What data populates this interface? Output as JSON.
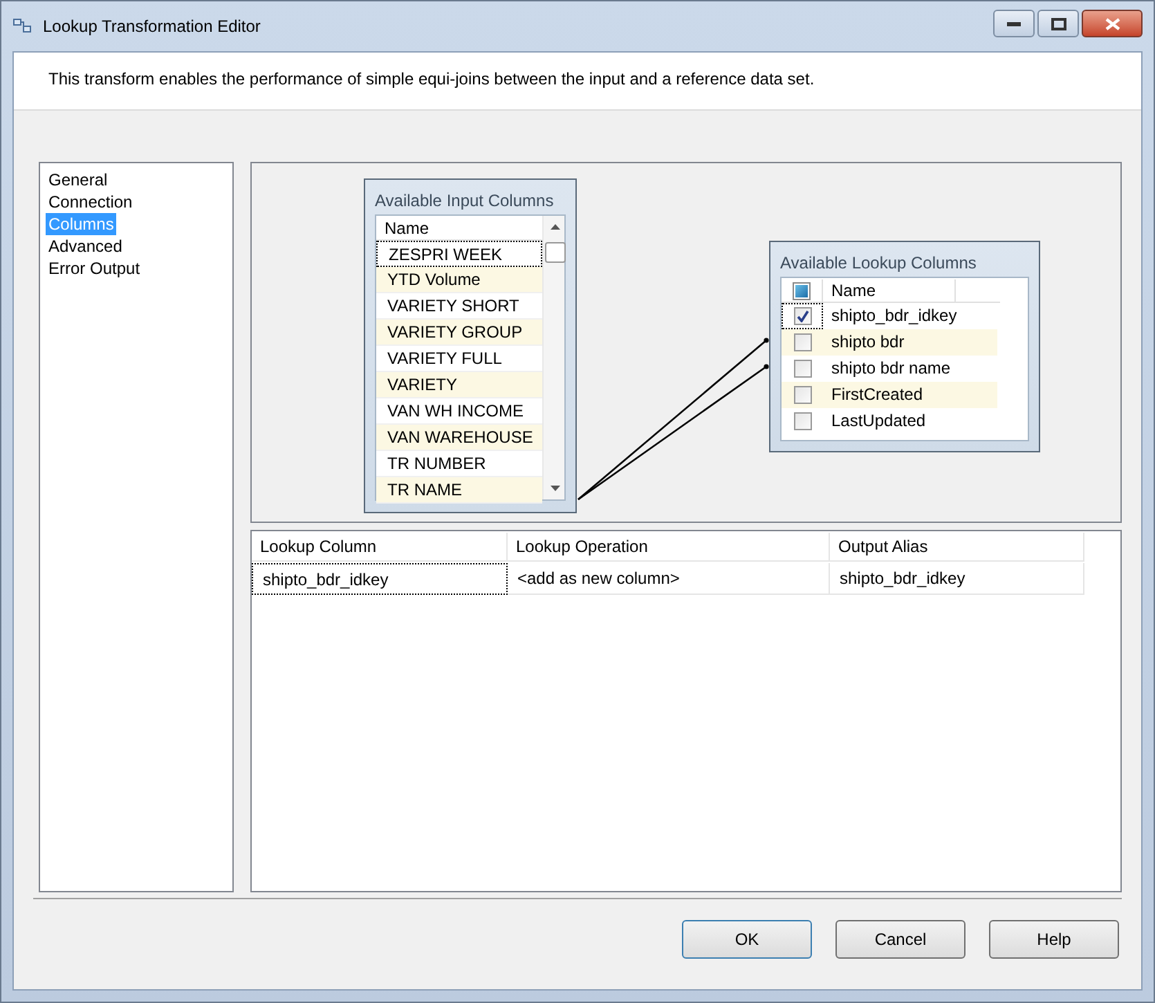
{
  "window": {
    "title": "Lookup Transformation Editor"
  },
  "description": "This transform enables the performance of simple equi-joins between the input and a reference data set.",
  "nav": [
    {
      "label": "General",
      "selected": false
    },
    {
      "label": "Connection",
      "selected": false
    },
    {
      "label": "Columns",
      "selected": true
    },
    {
      "label": "Advanced",
      "selected": false
    },
    {
      "label": "Error Output",
      "selected": false
    }
  ],
  "input_columns": {
    "title": "Available Input Columns",
    "header": "Name",
    "rows": [
      "ZESPRI WEEK",
      "YTD Volume",
      "VARIETY SHORT",
      "VARIETY GROUP",
      "VARIETY FULL",
      "VARIETY",
      "VAN WH INCOME",
      "VAN WAREHOUSE",
      "TR NUMBER",
      "TR NAME"
    ]
  },
  "lookup_columns": {
    "title": "Available Lookup Columns",
    "header": "Name",
    "header_mixed": true,
    "rows": [
      {
        "name": "shipto_bdr_idkey",
        "checked": true,
        "joined": false
      },
      {
        "name": "shipto bdr",
        "checked": false,
        "joined": true
      },
      {
        "name": "shipto bdr name",
        "checked": false,
        "joined": true
      },
      {
        "name": "FirstCreated",
        "checked": false,
        "joined": false
      },
      {
        "name": "LastUpdated",
        "checked": false,
        "joined": false
      }
    ]
  },
  "mappings": {
    "columns": [
      "Lookup Column",
      "Lookup Operation",
      "Output Alias"
    ],
    "rows": [
      [
        "shipto_bdr_idkey",
        "<add as new column>",
        "shipto_bdr_idkey"
      ]
    ]
  },
  "buttons": [
    "OK",
    "Cancel",
    "Help"
  ]
}
